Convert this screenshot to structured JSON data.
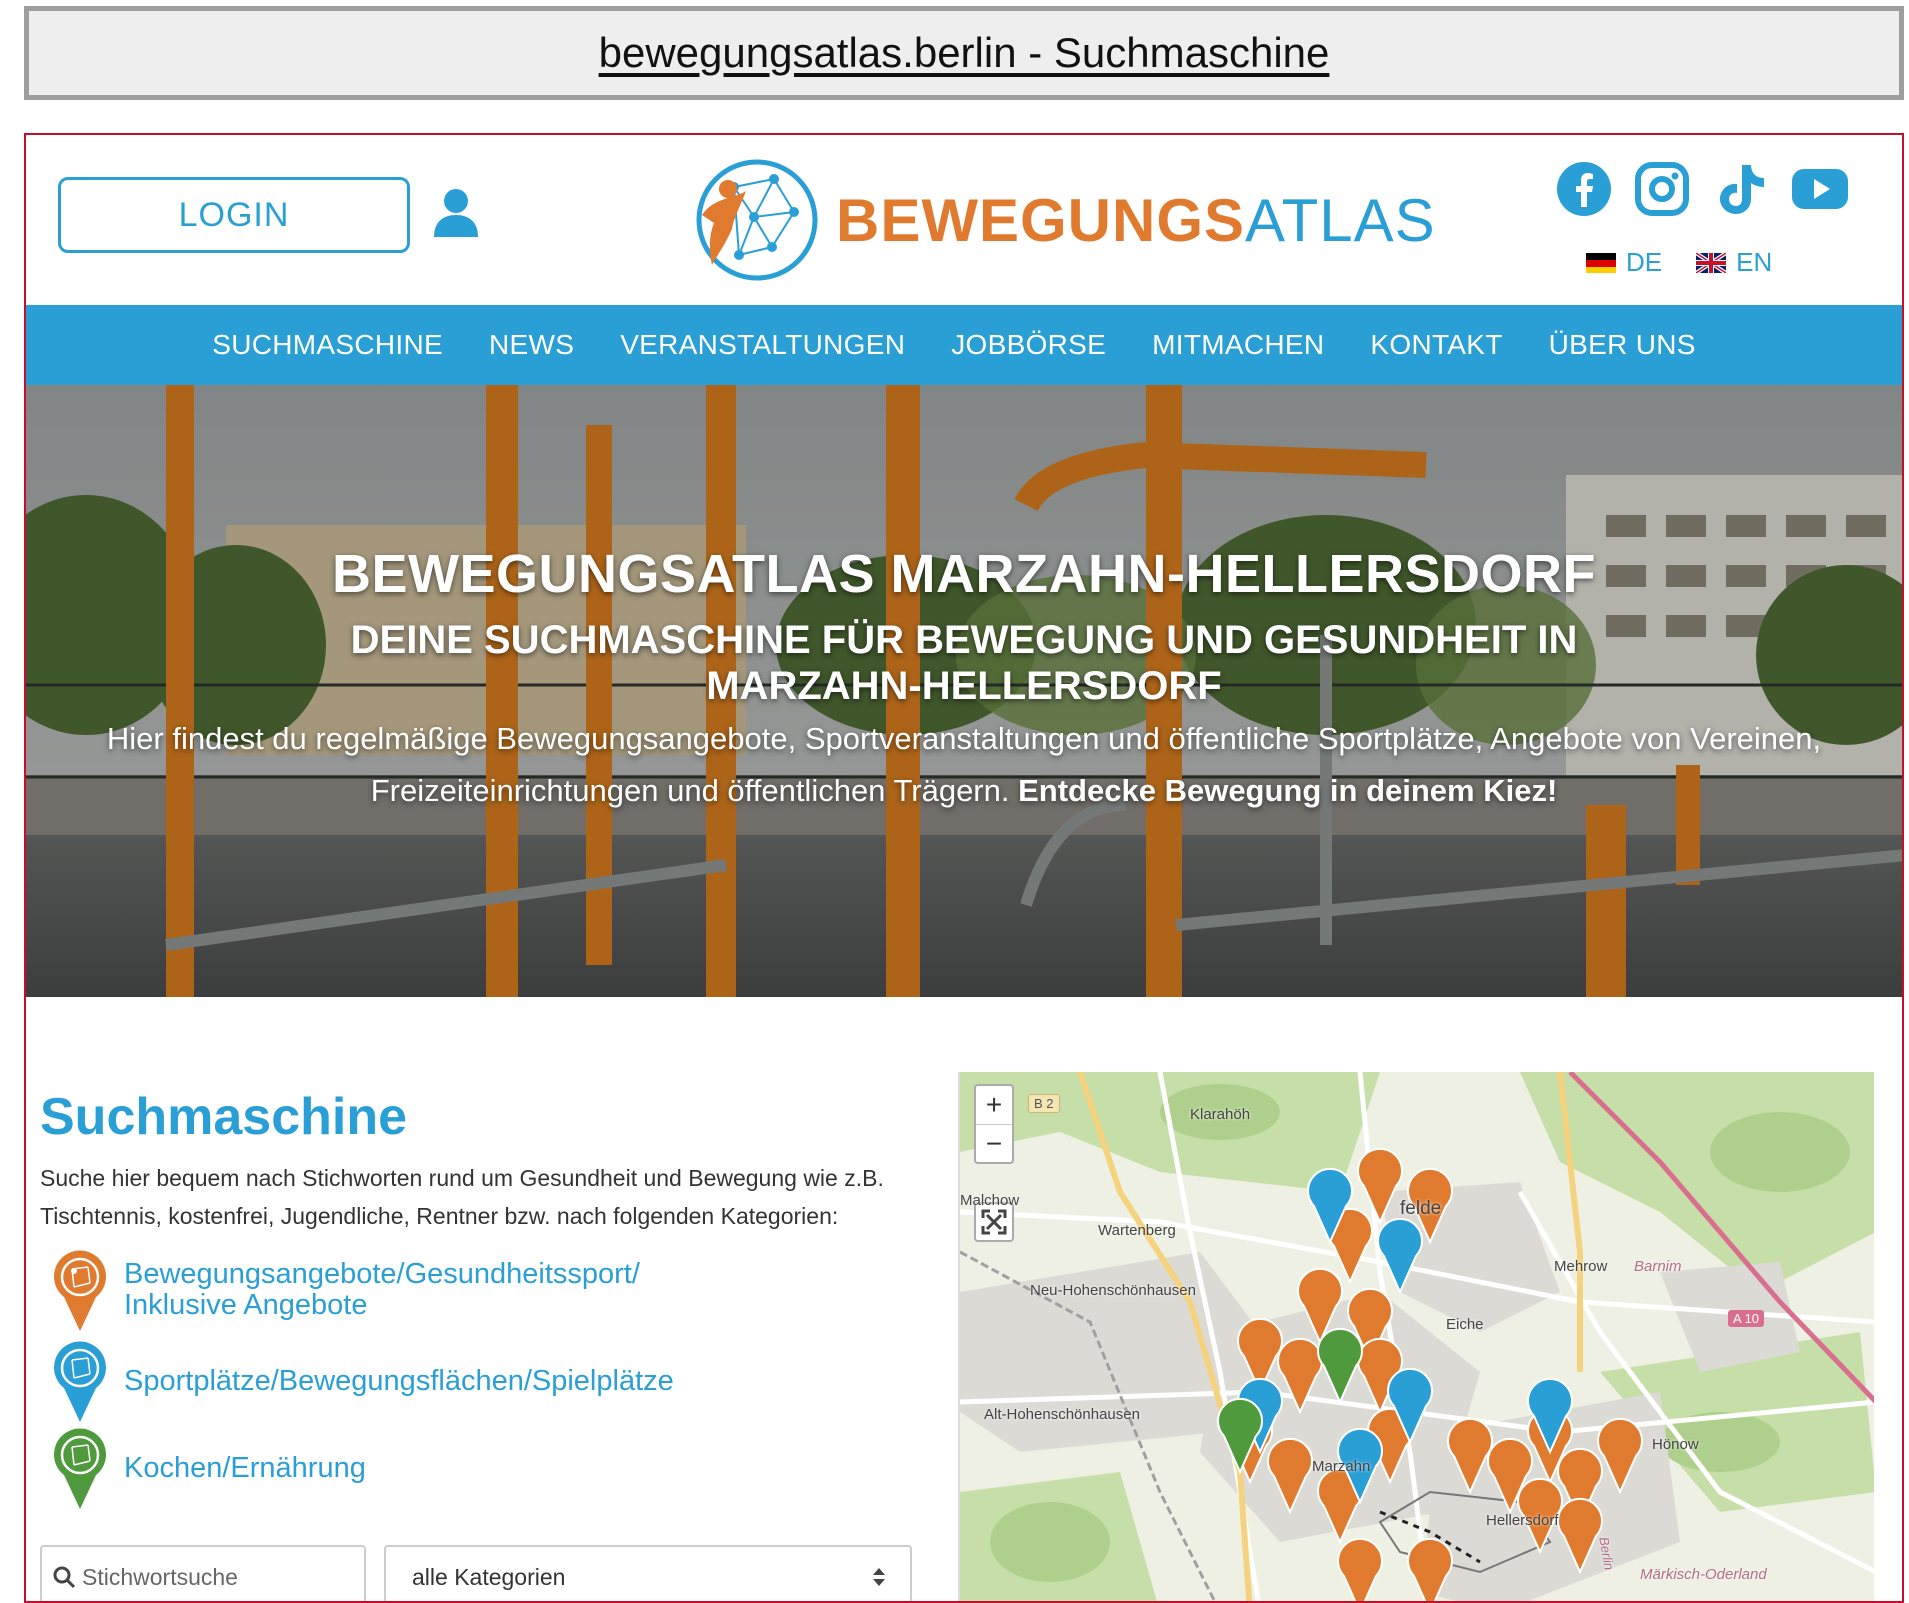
{
  "caption": "bewegungsatlas.berlin - Suchmaschine",
  "header": {
    "login_label": "LOGIN",
    "logo_part1": "BEWEGUNGS",
    "logo_part2": "ATLAS",
    "languages": [
      {
        "code": "DE",
        "flag": "de-flag-icon"
      },
      {
        "code": "EN",
        "flag": "uk-flag-icon"
      }
    ],
    "social_icons": [
      "facebook-icon",
      "instagram-icon",
      "tiktok-icon",
      "youtube-icon"
    ]
  },
  "nav": [
    "SUCHMASCHINE",
    "NEWS",
    "VERANSTALTUNGEN",
    "JOBBÖRSE",
    "MITMACHEN",
    "KONTAKT",
    "ÜBER UNS"
  ],
  "hero": {
    "title": "BEWEGUNGSATLAS MARZAHN-HELLERSDORF",
    "subtitle": "DEINE SUCHMASCHINE FÜR BEWEGUNG UND GESUNDHEIT IN MARZAHN-HELLERSDORF",
    "body": "Hier findest du regelmäßige Bewegungsangebote, Sportveranstaltungen und öffentliche Sportplätze, Angebote von Vereinen, Freizeiteinrichtungen und öffentlichen Trägern.",
    "body_bold": "Entdecke Bewegung in deinem Kiez!"
  },
  "search": {
    "title": "Suchmaschine",
    "description": "Suche hier bequem nach Stichworten rund um Gesundheit und Bewegung wie z.B. Tischtennis, kostenfrei, Jugendliche, Rentner bzw. nach folgenden Kategorien:",
    "categories": [
      {
        "label_line1": "Bewegungsangebote/Gesundheitssport/",
        "label_line2": "Inklusive Angebote",
        "color": "#e07a2e"
      },
      {
        "label_line1": "Sportplätze/Bewegungsflächen/Spielplätze",
        "label_line2": "",
        "color": "#2a9fd6"
      },
      {
        "label_line1": "Kochen/Ernährung",
        "label_line2": "",
        "color": "#4f9a3c"
      }
    ],
    "keyword_placeholder": "Stichwortsuche",
    "category_select_value": "alle Kategorien"
  },
  "map": {
    "zoom_in": "+",
    "zoom_out": "−",
    "places": [
      "Klarahöh",
      "Malchow",
      "Wartenberg",
      "Neu-Hohenschönhausen",
      "Alt-Hohenschönhausen",
      "Mehrow",
      "Eiche",
      "Hönow",
      "Marzahn",
      "Hellersdorf",
      "felde",
      "Barnim",
      "Märkisch-Oderland",
      "Berlin"
    ],
    "road_badges": [
      "B 2",
      "A 10"
    ]
  },
  "colors": {
    "primary_blue": "#2a9fd6",
    "brand_orange": "#e07a2e",
    "frame_red": "#c40e2a"
  }
}
